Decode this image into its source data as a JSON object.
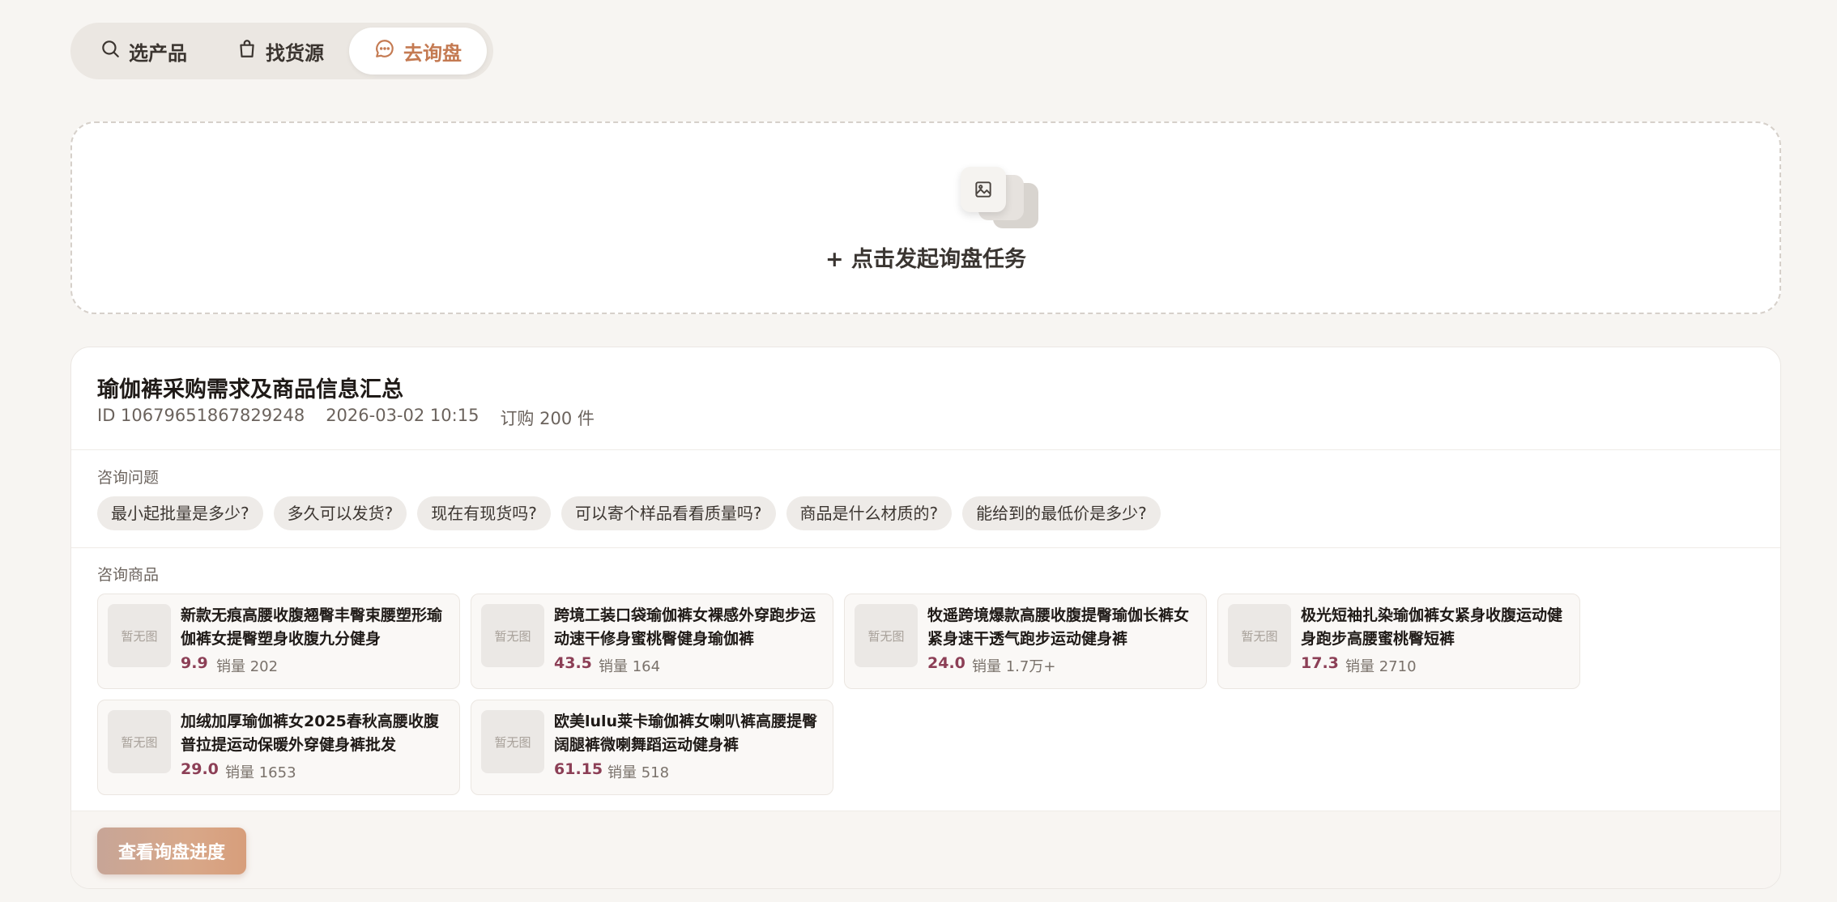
{
  "tabs": [
    {
      "label": "选产品",
      "icon": "search-icon"
    },
    {
      "label": "找货源",
      "icon": "bag-icon"
    },
    {
      "label": "去询盘",
      "icon": "chat-icon",
      "active": true
    }
  ],
  "dropzone": {
    "label": "+ 点击发起询盘任务",
    "icon": "image-stack-icon"
  },
  "inquiry": {
    "title": "瑜伽裤采购需求及商品信息汇总",
    "id_text": "ID 10679651867829248",
    "datetime": "2026-03-02 10:15",
    "order_text": "订购 200 件",
    "questions_label": "咨询问题",
    "questions": [
      "最小起批量是多少?",
      "多久可以发货?",
      "现在有现货吗?",
      "可以寄个样品看看质量吗?",
      "商品是什么材质的?",
      "能给到的最低价是多少?"
    ],
    "products_label": "咨询商品",
    "products": [
      {
        "thumb": "暂无图",
        "name": "新款无痕高腰收腹翘臀丰臀束腰塑形瑜伽裤女提臀塑身收腹九分健身",
        "price": "9.9",
        "sales": "销量 202"
      },
      {
        "thumb": "暂无图",
        "name": "跨境工装口袋瑜伽裤女裸感外穿跑步运动速干修身蜜桃臀健身瑜伽裤",
        "price": "43.5",
        "sales": "销量 164"
      },
      {
        "thumb": "暂无图",
        "name": "牧遥跨境爆款高腰收腹提臀瑜伽长裤女紧身速干透气跑步运动健身裤",
        "price": "24.0",
        "sales": "销量 1.7万+"
      },
      {
        "thumb": "暂无图",
        "name": "极光短袖扎染瑜伽裤女紧身收腹运动健身跑步高腰蜜桃臀短裤",
        "price": "17.3",
        "sales": "销量 2710"
      },
      {
        "thumb": "暂无图",
        "name": "加绒加厚瑜伽裤女2025春秋高腰收腹普拉提运动保暖外穿健身裤批发",
        "price": "29.0",
        "sales": "销量 1653"
      },
      {
        "thumb": "暂无图",
        "name": "欧美lulu莱卡瑜伽裤女喇叭裤高腰提臀阔腿裤微喇舞蹈运动健身裤",
        "price": "61.15",
        "sales": "销量 518"
      }
    ],
    "progress_button": "查看询盘进度"
  },
  "colors": {
    "accent": "#c47a52",
    "price": "#8c3f56",
    "background": "#f7f5f2"
  }
}
